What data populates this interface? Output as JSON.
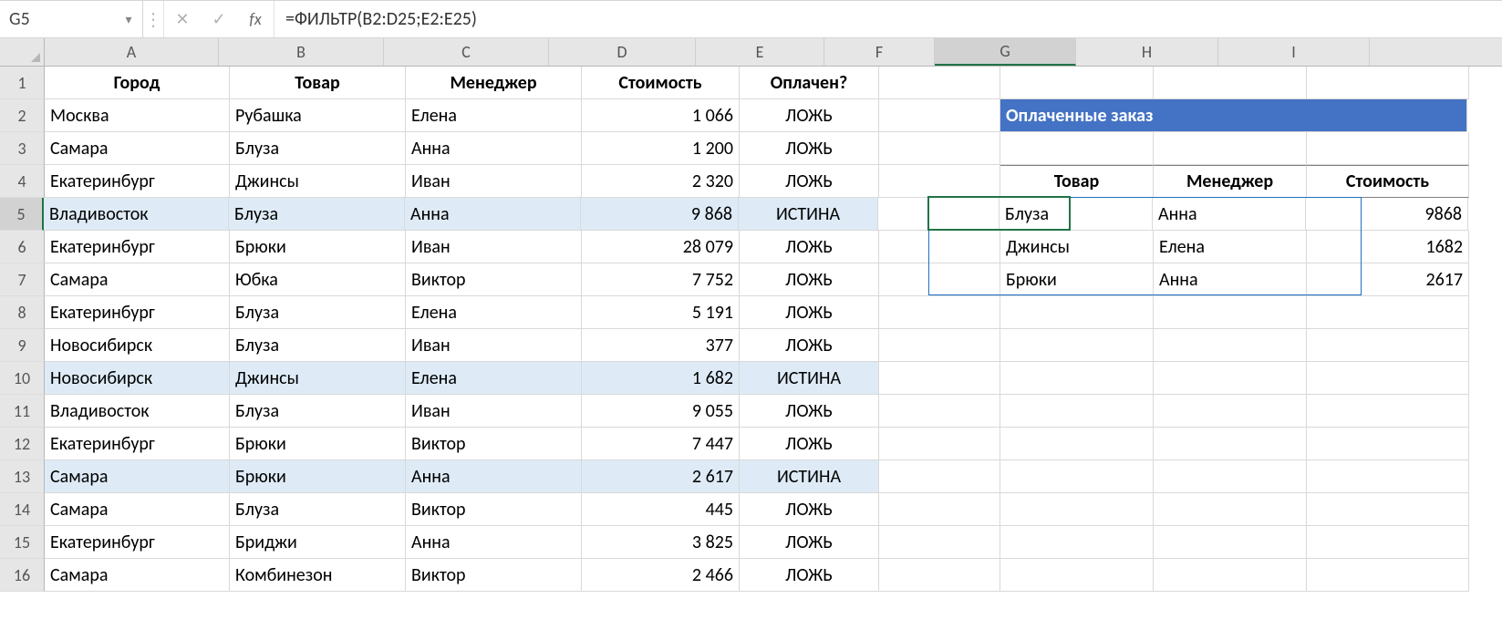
{
  "formula_bar": {
    "cell_ref": "G5",
    "formula": "=ФИЛЬТР(B2:D25;E2:E25)",
    "fx_label": "fx"
  },
  "columns": [
    "A",
    "B",
    "C",
    "D",
    "E",
    "F",
    "G",
    "H",
    "I"
  ],
  "row_numbers": [
    1,
    2,
    3,
    4,
    5,
    6,
    7,
    8,
    9,
    10,
    11,
    12,
    13,
    14,
    15,
    16
  ],
  "selected_cell": {
    "col": "G",
    "row": 5
  },
  "spill_range": {
    "col_start": "G",
    "col_end": "I",
    "row_start": 5,
    "row_end": 7
  },
  "left_table": {
    "headers": {
      "A": "Город",
      "B": "Товар",
      "C": "Менеджер",
      "D": "Стоимость",
      "E": "Оплачен?"
    },
    "rows": [
      {
        "A": "Москва",
        "B": "Рубашка",
        "C": "Елена",
        "D": "1 066",
        "E": "ЛОЖЬ",
        "hl": false
      },
      {
        "A": "Самара",
        "B": "Блуза",
        "C": "Анна",
        "D": "1 200",
        "E": "ЛОЖЬ",
        "hl": false
      },
      {
        "A": "Екатеринбург",
        "B": "Джинсы",
        "C": "Иван",
        "D": "2 320",
        "E": "ЛОЖЬ",
        "hl": false
      },
      {
        "A": "Владивосток",
        "B": "Блуза",
        "C": "Анна",
        "D": "9 868",
        "E": "ИСТИНА",
        "hl": true
      },
      {
        "A": "Екатеринбург",
        "B": "Брюки",
        "C": "Иван",
        "D": "28 079",
        "E": "ЛОЖЬ",
        "hl": false
      },
      {
        "A": "Самара",
        "B": "Юбка",
        "C": "Виктор",
        "D": "7 752",
        "E": "ЛОЖЬ",
        "hl": false
      },
      {
        "A": "Екатеринбург",
        "B": "Блуза",
        "C": "Елена",
        "D": "5 191",
        "E": "ЛОЖЬ",
        "hl": false
      },
      {
        "A": "Новосибирск",
        "B": "Блуза",
        "C": "Иван",
        "D": "377",
        "E": "ЛОЖЬ",
        "hl": false
      },
      {
        "A": "Новосибирск",
        "B": "Джинсы",
        "C": "Елена",
        "D": "1 682",
        "E": "ИСТИНА",
        "hl": true
      },
      {
        "A": "Владивосток",
        "B": "Блуза",
        "C": "Иван",
        "D": "9 055",
        "E": "ЛОЖЬ",
        "hl": false
      },
      {
        "A": "Екатеринбург",
        "B": "Брюки",
        "C": "Виктор",
        "D": "7 447",
        "E": "ЛОЖЬ",
        "hl": false
      },
      {
        "A": "Самара",
        "B": "Брюки",
        "C": "Анна",
        "D": "2 617",
        "E": "ИСТИНА",
        "hl": true
      },
      {
        "A": "Самара",
        "B": "Блуза",
        "C": "Виктор",
        "D": "445",
        "E": "ЛОЖЬ",
        "hl": false
      },
      {
        "A": "Екатеринбург",
        "B": "Бриджи",
        "C": "Анна",
        "D": "3 825",
        "E": "ЛОЖЬ",
        "hl": false
      },
      {
        "A": "Самара",
        "B": "Комбинезон",
        "C": "Виктор",
        "D": "2 466",
        "E": "ЛОЖЬ",
        "hl": false
      }
    ]
  },
  "right_panel": {
    "title": "Оплаченные заказы",
    "headers": {
      "G": "Товар",
      "H": "Менеджер",
      "I": "Стоимость"
    },
    "rows": [
      {
        "G": "Блуза",
        "H": "Анна",
        "I": "9868"
      },
      {
        "G": "Джинсы",
        "H": "Елена",
        "I": "1682"
      },
      {
        "G": "Брюки",
        "H": "Анна",
        "I": "2617"
      }
    ]
  }
}
